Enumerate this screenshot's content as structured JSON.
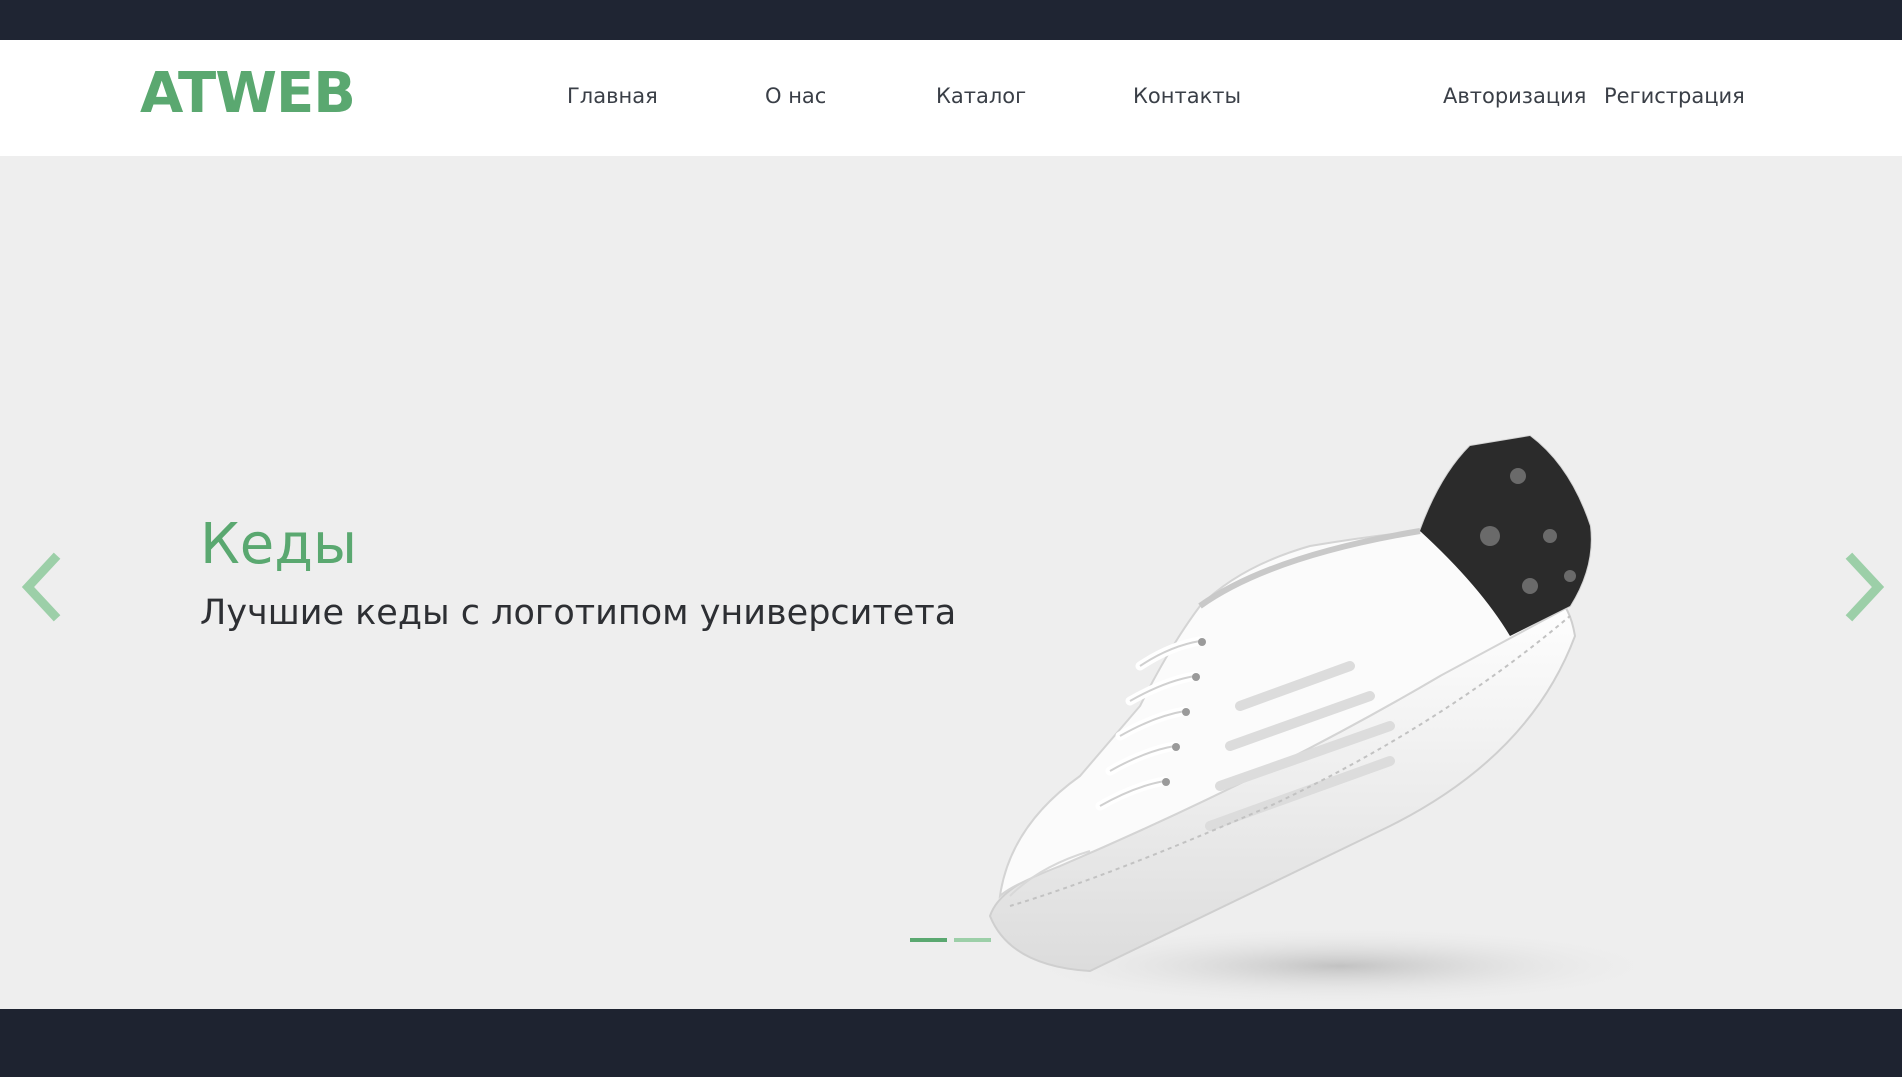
{
  "header": {
    "logo": "ATWEB",
    "nav": [
      {
        "label": "Главная"
      },
      {
        "label": "О нас"
      },
      {
        "label": "Каталог"
      },
      {
        "label": "Контакты"
      }
    ],
    "auth": {
      "login": "Авторизация",
      "register": "Регистрация"
    }
  },
  "carousel": {
    "title": "Кеды",
    "subtitle": "Лучшие кеды с логотипом университета",
    "prev_icon": "chevron-left-icon",
    "next_icon": "chevron-right-icon",
    "slide_count": 2,
    "active_slide": 1,
    "image": "white-sneaker-with-dark-patterned-heel"
  },
  "colors": {
    "accent": "#5aa870",
    "accent_light": "#9ccfa8",
    "dark_bar": "#1f2533",
    "hero_bg": "#eeeeee",
    "nav_text": "#3a3f47"
  }
}
